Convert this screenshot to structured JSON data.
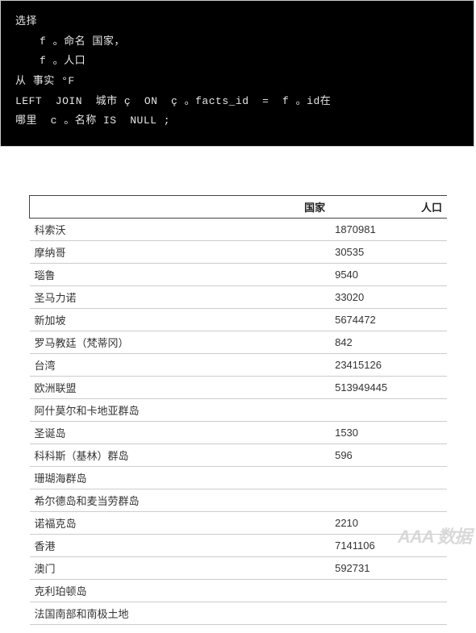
{
  "code": {
    "lines": [
      {
        "text": "选择",
        "indent": 0
      },
      {
        "text": "f 。命名 国家，",
        "indent": 1
      },
      {
        "text": "f 。人口",
        "indent": 1
      },
      {
        "text": "从 事实 °F",
        "indent": 0
      },
      {
        "text": "LEFT  JOIN  城市 ç  ON  ç 。facts_id  =  f 。id在",
        "indent": 0
      },
      {
        "text": "哪里  c 。名称 IS  NULL ;",
        "indent": 0
      }
    ]
  },
  "table": {
    "headers": [
      "国家",
      "人口"
    ],
    "rows": [
      {
        "country": "科索沃",
        "pop": "1870981"
      },
      {
        "country": "摩纳哥",
        "pop": "30535"
      },
      {
        "country": "瑙鲁",
        "pop": "9540"
      },
      {
        "country": "圣马力诺",
        "pop": "33020"
      },
      {
        "country": "新加坡",
        "pop": "5674472"
      },
      {
        "country": "罗马教廷（梵蒂冈）",
        "pop": "842"
      },
      {
        "country": "台湾",
        "pop": "23415126"
      },
      {
        "country": "欧洲联盟",
        "pop": "513949445"
      },
      {
        "country": "阿什莫尔和卡地亚群岛",
        "pop": ""
      },
      {
        "country": "圣诞岛",
        "pop": "1530"
      },
      {
        "country": "科科斯（基林）群岛",
        "pop": "596"
      },
      {
        "country": "珊瑚海群岛",
        "pop": ""
      },
      {
        "country": "希尔德岛和麦当劳群岛",
        "pop": ""
      },
      {
        "country": "诺福克岛",
        "pop": "2210"
      },
      {
        "country": "香港",
        "pop": "7141106"
      },
      {
        "country": "澳门",
        "pop": "592731"
      },
      {
        "country": "克利珀顿岛",
        "pop": ""
      },
      {
        "country": "法国南部和南极土地",
        "pop": ""
      }
    ]
  },
  "watermark": "AAA 数据"
}
